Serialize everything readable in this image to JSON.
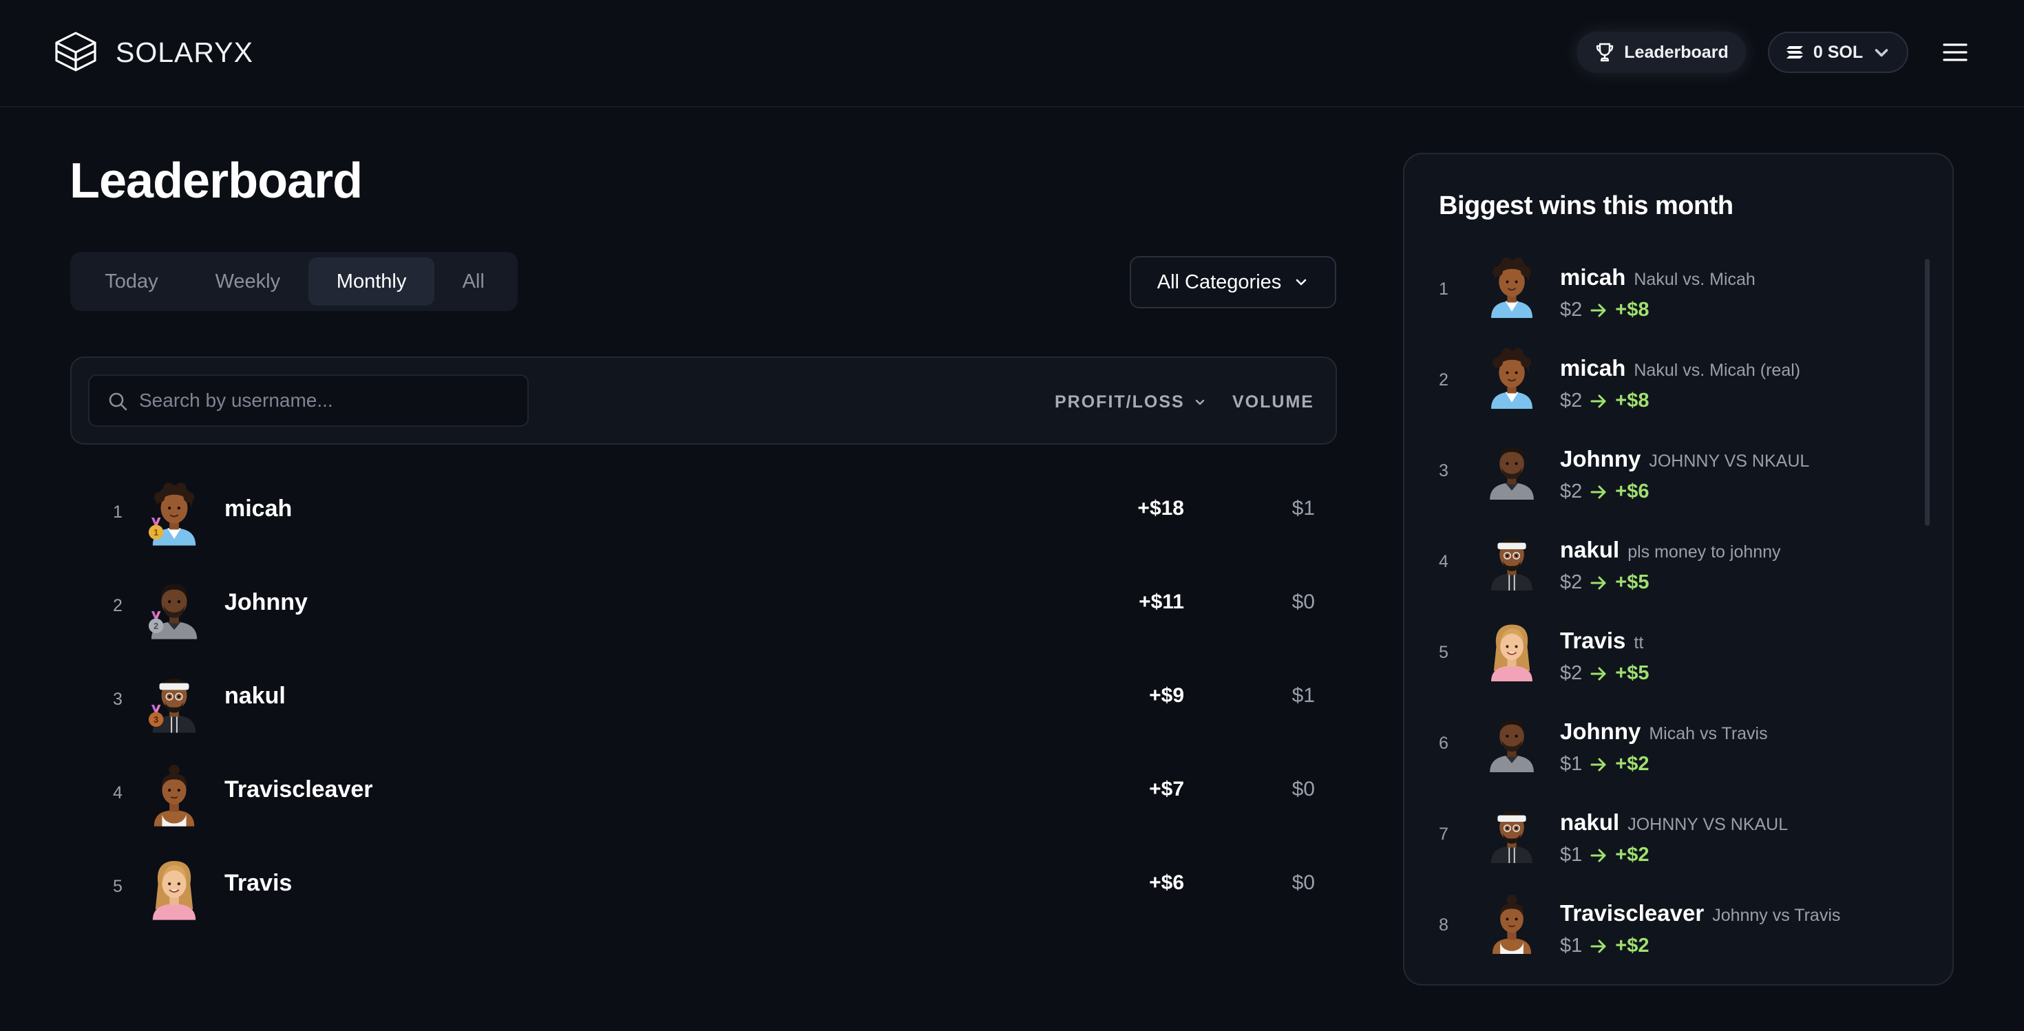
{
  "header": {
    "logo_text": "SOLARYX",
    "leaderboard_label": "Leaderboard",
    "balance_label": "0 SOL"
  },
  "page": {
    "title": "Leaderboard"
  },
  "tabs": [
    {
      "label": "Today"
    },
    {
      "label": "Weekly"
    },
    {
      "label": "Monthly",
      "active": true
    },
    {
      "label": "All"
    }
  ],
  "category_select": {
    "label": "All Categories"
  },
  "search": {
    "placeholder": "Search by username..."
  },
  "columns": {
    "profit": "PROFIT/LOSS",
    "volume": "VOLUME"
  },
  "rows": [
    {
      "rank": "1",
      "name": "micah",
      "profit": "+$18",
      "volume": "$1",
      "medal": "gold"
    },
    {
      "rank": "2",
      "name": "Johnny",
      "profit": "+$11",
      "volume": "$0",
      "medal": "silver"
    },
    {
      "rank": "3",
      "name": "nakul",
      "profit": "+$9",
      "volume": "$1",
      "medal": "bronze"
    },
    {
      "rank": "4",
      "name": "Traviscleaver",
      "profit": "+$7",
      "volume": "$0"
    },
    {
      "rank": "5",
      "name": "Travis",
      "profit": "+$6",
      "volume": "$0"
    }
  ],
  "wins": {
    "title": "Biggest wins this month",
    "items": [
      {
        "rank": "1",
        "name": "micah",
        "game": "Nakul vs. Micah",
        "bet": "$2",
        "gain": "+$8"
      },
      {
        "rank": "2",
        "name": "micah",
        "game": "Nakul vs. Micah (real)",
        "bet": "$2",
        "gain": "+$8"
      },
      {
        "rank": "3",
        "name": "Johnny",
        "game": "JOHNNY VS NKAUL",
        "bet": "$2",
        "gain": "+$6"
      },
      {
        "rank": "4",
        "name": "nakul",
        "game": "pls money to johnny",
        "bet": "$2",
        "gain": "+$5"
      },
      {
        "rank": "5",
        "name": "Travis",
        "game": "tt",
        "bet": "$2",
        "gain": "+$5"
      },
      {
        "rank": "6",
        "name": "Johnny",
        "game": "Micah vs Travis",
        "bet": "$1",
        "gain": "+$2"
      },
      {
        "rank": "7",
        "name": "nakul",
        "game": "JOHNNY VS NKAUL",
        "bet": "$1",
        "gain": "+$2"
      },
      {
        "rank": "8",
        "name": "Traviscleaver",
        "game": "Johnny vs Travis",
        "bet": "$1",
        "gain": "+$2"
      }
    ]
  },
  "colors": {
    "background": "#0b0e15",
    "gain_green": "#9fe06f",
    "medal_gold": "#e8b23a",
    "medal_silver": "#a9adb5",
    "medal_bronze": "#b8692f"
  },
  "icons": {
    "logo": "stacked-layers-icon",
    "leaderboard": "trophy-icon",
    "balance": "solana-icon",
    "balance_dropdown": "chevron-down-icon",
    "menu": "hamburger-menu-icon",
    "category_dropdown": "chevron-down-icon",
    "search": "search-icon",
    "sort": "chevron-down-icon",
    "gain": "arrow-right-icon"
  }
}
